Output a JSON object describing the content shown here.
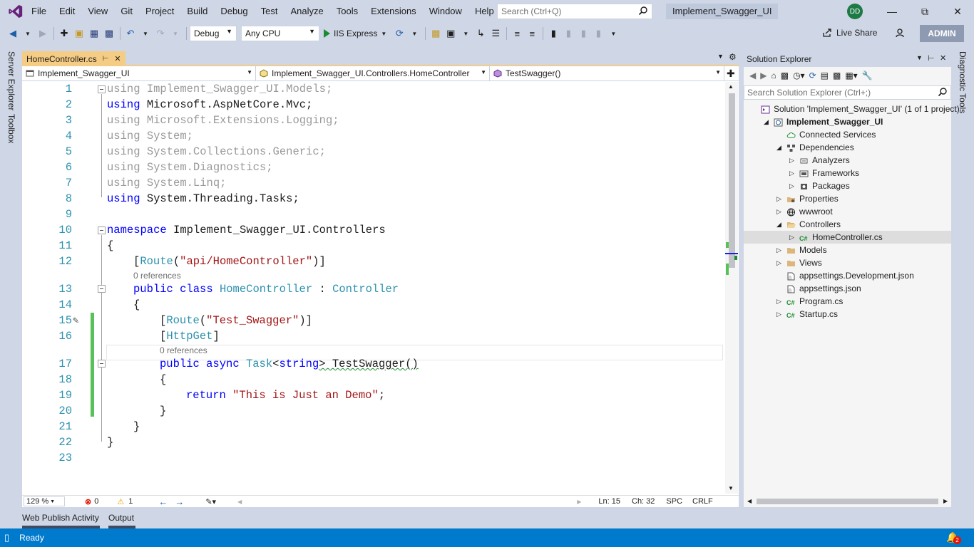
{
  "menu": {
    "items": [
      "File",
      "Edit",
      "View",
      "Git",
      "Project",
      "Build",
      "Debug",
      "Test",
      "Analyze",
      "Tools",
      "Extensions",
      "Window",
      "Help"
    ],
    "search_placeholder": "Search (Ctrl+Q)",
    "solution_name": "Implement_Swagger_UI",
    "avatar_initials": "DD"
  },
  "toolbar": {
    "config": "Debug",
    "platform": "Any CPU",
    "run_label": "IIS Express",
    "live_share": "Live Share",
    "admin": "ADMIN"
  },
  "side": {
    "left": [
      "Server Explorer",
      "Toolbox"
    ],
    "right": "Diagnostic Tools"
  },
  "editor": {
    "tab": "HomeController.cs",
    "nav": {
      "project": "Implement_Swagger_UI",
      "class": "Implement_Swagger_UI.Controllers.HomeController",
      "member": "TestSwagger()"
    },
    "lines": [
      {
        "n": "1",
        "indent": 0,
        "parts": [
          [
            "kw dim",
            "using"
          ],
          [
            "dim",
            " Implement_Swagger_UI.Models;"
          ]
        ]
      },
      {
        "n": "2",
        "indent": 0,
        "parts": [
          [
            "kw",
            "using"
          ],
          [
            "",
            " Microsoft.AspNetCore.Mvc;"
          ]
        ]
      },
      {
        "n": "3",
        "indent": 0,
        "parts": [
          [
            "kw dim",
            "using"
          ],
          [
            "dim",
            " Microsoft.Extensions.Logging;"
          ]
        ]
      },
      {
        "n": "4",
        "indent": 0,
        "parts": [
          [
            "kw dim",
            "using"
          ],
          [
            "dim",
            " System;"
          ]
        ]
      },
      {
        "n": "5",
        "indent": 0,
        "parts": [
          [
            "kw dim",
            "using"
          ],
          [
            "dim",
            " System.Collections.Generic;"
          ]
        ]
      },
      {
        "n": "6",
        "indent": 0,
        "parts": [
          [
            "kw dim",
            "using"
          ],
          [
            "dim",
            " System.Diagnostics;"
          ]
        ]
      },
      {
        "n": "7",
        "indent": 0,
        "parts": [
          [
            "kw dim",
            "using"
          ],
          [
            "dim",
            " System.Linq;"
          ]
        ]
      },
      {
        "n": "8",
        "indent": 0,
        "parts": [
          [
            "kw",
            "using"
          ],
          [
            "",
            " System.Threading.Tasks;"
          ]
        ]
      },
      {
        "n": "9",
        "indent": 0,
        "parts": []
      },
      {
        "n": "10",
        "indent": 0,
        "parts": [
          [
            "kw",
            "namespace"
          ],
          [
            "",
            " Implement_Swagger_UI.Controllers"
          ]
        ]
      },
      {
        "n": "11",
        "indent": 0,
        "parts": [
          [
            "",
            "{"
          ]
        ]
      },
      {
        "n": "12",
        "indent": 1,
        "parts": [
          [
            "",
            "["
          ],
          [
            "ty",
            "Route"
          ],
          [
            "",
            "("
          ],
          [
            "st",
            "\"api/HomeController\""
          ],
          [
            "",
            ")]"
          ]
        ]
      },
      {
        "n": "13",
        "indent": 1,
        "parts": [
          [
            "kw",
            "public class"
          ],
          [
            "",
            " "
          ],
          [
            "ty",
            "HomeController"
          ],
          [
            "",
            " : "
          ],
          [
            "ty",
            "Controller"
          ]
        ]
      },
      {
        "n": "14",
        "indent": 1,
        "parts": [
          [
            "",
            "{"
          ]
        ]
      },
      {
        "n": "15",
        "indent": 2,
        "parts": [
          [
            "",
            "["
          ],
          [
            "ty",
            "Route"
          ],
          [
            "",
            "("
          ],
          [
            "st",
            "\"Test_Swagger\""
          ],
          [
            "",
            ")]"
          ]
        ]
      },
      {
        "n": "16",
        "indent": 2,
        "parts": [
          [
            "",
            "["
          ],
          [
            "ty",
            "HttpGet"
          ],
          [
            "",
            "]"
          ]
        ]
      },
      {
        "n": "17",
        "indent": 2,
        "parts": [
          [
            "kw",
            "public async"
          ],
          [
            "",
            " "
          ],
          [
            "ty",
            "Task"
          ],
          [
            "",
            "<"
          ],
          [
            "kw",
            "string"
          ],
          [
            "",
            "> TestSwagger()"
          ]
        ]
      },
      {
        "n": "18",
        "indent": 2,
        "parts": [
          [
            "",
            "{"
          ]
        ]
      },
      {
        "n": "19",
        "indent": 3,
        "parts": [
          [
            "kw",
            "return"
          ],
          [
            "",
            " "
          ],
          [
            "st",
            "\"This is Just an Demo\""
          ],
          [
            "",
            ";"
          ]
        ]
      },
      {
        "n": "20",
        "indent": 2,
        "parts": [
          [
            "",
            "}"
          ]
        ]
      },
      {
        "n": "21",
        "indent": 1,
        "parts": [
          [
            "",
            "}"
          ]
        ]
      },
      {
        "n": "22",
        "indent": 0,
        "parts": [
          [
            "",
            "}"
          ]
        ]
      },
      {
        "n": "23",
        "indent": 0,
        "parts": []
      }
    ],
    "lens_label": "0 references",
    "status": {
      "zoom": "129 %",
      "errors": "0",
      "warnings": "1",
      "ln": "Ln: 15",
      "ch": "Ch: 32",
      "spc": "SPC",
      "crlf": "CRLF"
    }
  },
  "solution_explorer": {
    "title": "Solution Explorer",
    "search_placeholder": "Search Solution Explorer (Ctrl+;)",
    "nodes": [
      {
        "label": "Solution 'Implement_Swagger_UI' (1 of 1 project)",
        "depth": 0,
        "exp": "",
        "icon": "solution",
        "bold": false
      },
      {
        "label": "Implement_Swagger_UI",
        "depth": 1,
        "exp": "◢",
        "icon": "web-project",
        "bold": true
      },
      {
        "label": "Connected Services",
        "depth": 2,
        "exp": "",
        "icon": "cloud",
        "bold": false
      },
      {
        "label": "Dependencies",
        "depth": 2,
        "exp": "◢",
        "icon": "dependencies",
        "bold": false
      },
      {
        "label": "Analyzers",
        "depth": 3,
        "exp": "▷",
        "icon": "analyzer",
        "bold": false
      },
      {
        "label": "Frameworks",
        "depth": 3,
        "exp": "▷",
        "icon": "framework",
        "bold": false
      },
      {
        "label": "Packages",
        "depth": 3,
        "exp": "▷",
        "icon": "package",
        "bold": false
      },
      {
        "label": "Properties",
        "depth": 2,
        "exp": "▷",
        "icon": "properties",
        "bold": false
      },
      {
        "label": "wwwroot",
        "depth": 2,
        "exp": "▷",
        "icon": "globe",
        "bold": false
      },
      {
        "label": "Controllers",
        "depth": 2,
        "exp": "◢",
        "icon": "folder-open",
        "bold": false
      },
      {
        "label": "HomeController.cs",
        "depth": 3,
        "exp": "▷",
        "icon": "csharp",
        "bold": false,
        "selected": true
      },
      {
        "label": "Models",
        "depth": 2,
        "exp": "▷",
        "icon": "folder",
        "bold": false
      },
      {
        "label": "Views",
        "depth": 2,
        "exp": "▷",
        "icon": "folder",
        "bold": false
      },
      {
        "label": "appsettings.Development.json",
        "depth": 2,
        "exp": "",
        "icon": "json",
        "bold": false
      },
      {
        "label": "appsettings.json",
        "depth": 2,
        "exp": "",
        "icon": "json",
        "bold": false
      },
      {
        "label": "Program.cs",
        "depth": 2,
        "exp": "▷",
        "icon": "csharp",
        "bold": false
      },
      {
        "label": "Startup.cs",
        "depth": 2,
        "exp": "▷",
        "icon": "csharp",
        "bold": false
      }
    ]
  },
  "bottom": {
    "tabs": [
      "Web Publish Activity",
      "Output"
    ],
    "status": "Ready",
    "notifications": "2"
  },
  "colors": {
    "accent": "#007acc",
    "chrome": "#cfd6e5",
    "tab_active": "#f5cc84",
    "keyword": "#0000ff",
    "type": "#2b91af",
    "string": "#a31515"
  }
}
